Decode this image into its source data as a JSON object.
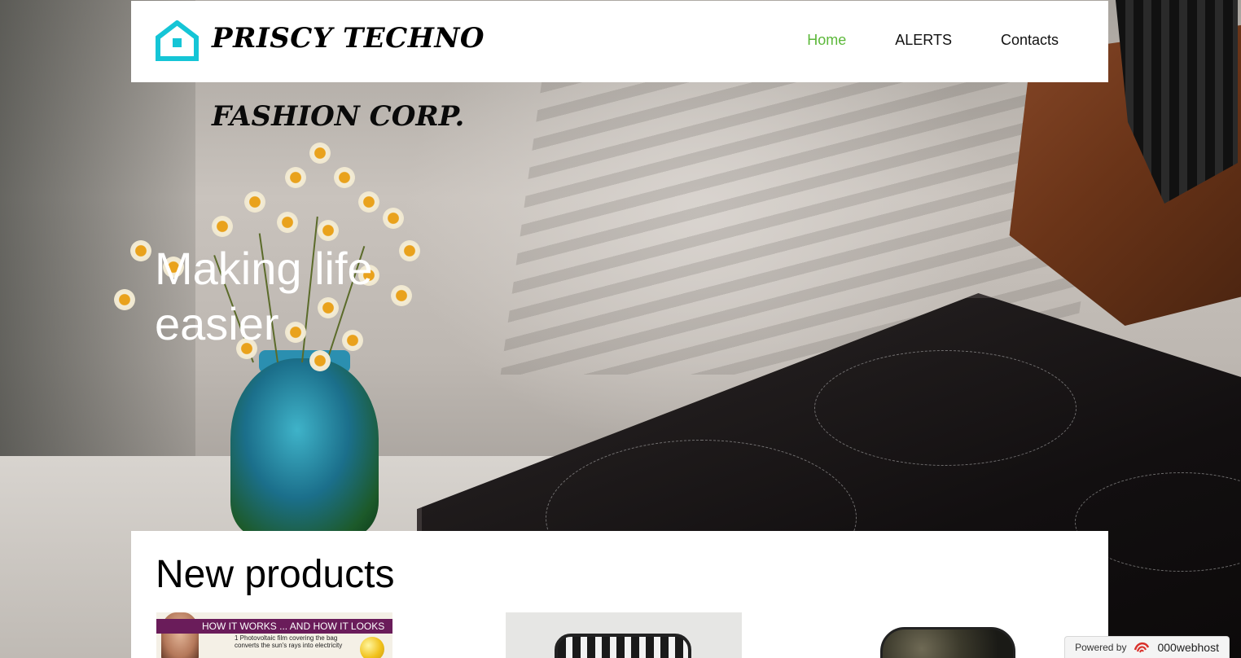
{
  "header": {
    "brand": "PRISCY TECHNO",
    "logo_icon": "house-icon",
    "nav": [
      {
        "label": "Home",
        "active": true
      },
      {
        "label": "ALERTS",
        "active": false
      },
      {
        "label": "Contacts",
        "active": false
      }
    ]
  },
  "hero": {
    "subbrand": "FASHION CORP.",
    "tagline_line1": "Making life",
    "tagline_line2": "easier"
  },
  "products": {
    "title": "New products",
    "items": [
      {
        "banner": "HOW IT WORKS ... AND HOW IT LOOKS",
        "caption_line1": "1 Photovoltaic film covering the bag",
        "caption_line2": "converts the sun's rays into electricity"
      },
      {},
      {}
    ]
  },
  "badge": {
    "powered_label": "Powered by",
    "host_name": "000webhost"
  },
  "colors": {
    "accent_icon": "#15c5d6",
    "nav_active": "#5cb83a",
    "header_bg": "#ffffff",
    "hero_text": "#ffffff"
  }
}
